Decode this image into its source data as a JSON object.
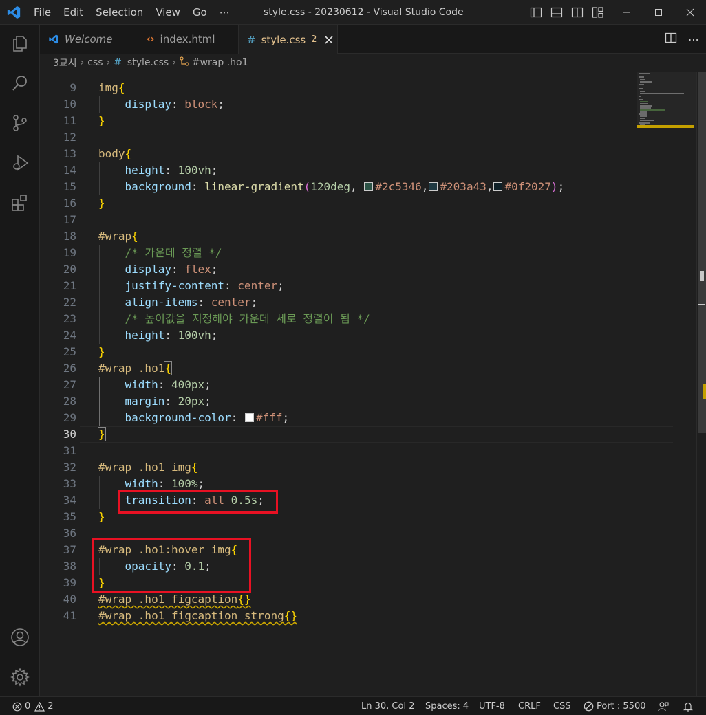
{
  "window": {
    "title": "style.css - 20230612 - Visual Studio Code",
    "accent": "#0078d4"
  },
  "menu": [
    "File",
    "Edit",
    "Selection",
    "View",
    "Go",
    "⋯"
  ],
  "tabs": [
    {
      "label": "Welcome",
      "icon": "vscode-icon"
    },
    {
      "label": "index.html",
      "icon": "html-icon"
    },
    {
      "label": "style.css",
      "badge": "2",
      "icon": "css-hash-icon"
    }
  ],
  "breadcrumb": [
    "3교시",
    "css",
    "style.css",
    "#wrap .ho1"
  ],
  "status": {
    "errors": "0",
    "warnings": "2",
    "position": "Ln 30, Col 2",
    "spaces": "Spaces: 4",
    "encoding": "UTF-8",
    "eol": "CRLF",
    "language": "CSS",
    "port": "Port : 5500"
  },
  "swatches": {
    "c1": "#2c5346",
    "c2": "#203a43",
    "c3": "#0f2027",
    "c4": "#ffffff"
  },
  "lines": [
    {
      "n": "9"
    },
    {
      "n": "10"
    },
    {
      "n": "11"
    },
    {
      "n": "12"
    },
    {
      "n": "13"
    },
    {
      "n": "14"
    },
    {
      "n": "15"
    },
    {
      "n": "16"
    },
    {
      "n": "17"
    },
    {
      "n": "18"
    },
    {
      "n": "19"
    },
    {
      "n": "20"
    },
    {
      "n": "21"
    },
    {
      "n": "22"
    },
    {
      "n": "23"
    },
    {
      "n": "24"
    },
    {
      "n": "25"
    },
    {
      "n": "26"
    },
    {
      "n": "27"
    },
    {
      "n": "28"
    },
    {
      "n": "29"
    },
    {
      "n": "30"
    },
    {
      "n": "31"
    },
    {
      "n": "32"
    },
    {
      "n": "33"
    },
    {
      "n": "34"
    },
    {
      "n": "35"
    },
    {
      "n": "36"
    },
    {
      "n": "37"
    },
    {
      "n": "38"
    },
    {
      "n": "39"
    },
    {
      "n": "40"
    },
    {
      "n": "41"
    }
  ],
  "code": {
    "l9a": "img",
    "l9b": "{",
    "l10a": "display",
    "l10b": ": ",
    "l10c": "block",
    "l10d": ";",
    "l11": "}",
    "l13a": "body",
    "l13b": "{",
    "l14a": "height",
    "l14b": ": ",
    "l14c": "100vh",
    "l14d": ";",
    "l15a": "background",
    "l15b": ": ",
    "l15c": "linear-gradient",
    "l15d": "(",
    "l15e": "120deg",
    "l15f": ", ",
    "l15g": "#2c5346",
    "l15h": ",",
    "l15i": "#203a43",
    "l15j": ",",
    "l15k": "#0f2027",
    "l15l": ")",
    "l15m": ";",
    "l16": "}",
    "l18a": "#wrap",
    "l18b": "{",
    "l19": "/* 가운데 정렬 */",
    "l20a": "display",
    "l20b": ": ",
    "l20c": "flex",
    "l20d": ";",
    "l21a": "justify-content",
    "l21b": ": ",
    "l21c": "center",
    "l21d": ";",
    "l22a": "align-items",
    "l22b": ": ",
    "l22c": "center",
    "l22d": ";",
    "l23": "/* 높이값을 지정해야 가운데 세로 정렬이 됨 */",
    "l24a": "height",
    "l24b": ": ",
    "l24c": "100vh",
    "l24d": ";",
    "l25": "}",
    "l26a": "#wrap .ho1",
    "l26b": "{",
    "l27a": "width",
    "l27b": ": ",
    "l27c": "400px",
    "l27d": ";",
    "l28a": "margin",
    "l28b": ": ",
    "l28c": "20px",
    "l28d": ";",
    "l29a": "background-color",
    "l29b": ": ",
    "l29c": "#fff",
    "l29d": ";",
    "l30": "}",
    "l32a": "#wrap .ho1 img",
    "l32b": "{",
    "l33a": "width",
    "l33b": ": ",
    "l33c": "100%",
    "l33d": ";",
    "l34a": "transition",
    "l34b": ": ",
    "l34c": "all",
    "l34d": " ",
    "l34e": "0.5s",
    "l34f": ";",
    "l35": "}",
    "l37a": "#wrap .ho1:hover img",
    "l37b": "{",
    "l38a": "opacity",
    "l38b": ": ",
    "l38c": "0.1",
    "l38d": ";",
    "l39": "}",
    "l40a": "#wrap .ho1 figcaption",
    "l40b": "{}",
    "l41a": "#wrap .ho1 figcaption strong",
    "l41b": "{}"
  }
}
